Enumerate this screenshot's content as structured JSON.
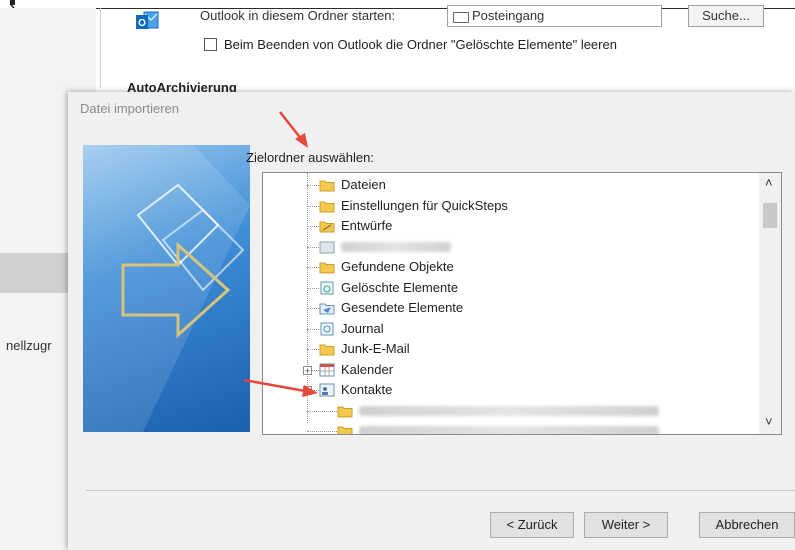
{
  "options_window": {
    "start_label": "Outlook in diesem Ordner starten:",
    "start_folder": "Posteingang",
    "search_button": "Suche...",
    "empty_deleted_label": "Beim Beenden von Outlook die Ordner \"Gelöschte Elemente\" leeren",
    "autoarchive_heading": "AutoArchivierung",
    "sidebar_label": "nellzugr"
  },
  "dialog": {
    "title": "Datei importieren",
    "target_label": "Zielordner auswählen:",
    "folders": [
      {
        "label": "Dateien",
        "icon": "folder-icon"
      },
      {
        "label": "Einstellungen für QuickSteps",
        "icon": "folder-icon"
      },
      {
        "label": "Entwürfe",
        "icon": "drafts-folder-icon"
      },
      {
        "label": "",
        "icon": "blurred-folder-icon",
        "blurred": true
      },
      {
        "label": "Gefundene Objekte",
        "icon": "folder-icon"
      },
      {
        "label": "Gelöschte Elemente",
        "icon": "trash-folder-icon"
      },
      {
        "label": "Gesendete Elemente",
        "icon": "sent-folder-icon"
      },
      {
        "label": "Journal",
        "icon": "journal-icon"
      },
      {
        "label": "Junk-E-Mail",
        "icon": "folder-icon"
      },
      {
        "label": "Kalender",
        "icon": "calendar-icon",
        "expander": "+"
      },
      {
        "label": "Kontakte",
        "icon": "contacts-icon",
        "expander": "-"
      },
      {
        "label": "",
        "icon": "folder-icon",
        "blurred": true
      },
      {
        "label": "",
        "icon": "folder-icon",
        "blurred": true
      }
    ],
    "buttons": {
      "back": "< Zurück",
      "next": "Weiter >",
      "cancel": "Abbrechen"
    }
  },
  "colors": {
    "annotation_arrow": "#e8473c",
    "folder_yellow": "#f2c94c"
  }
}
